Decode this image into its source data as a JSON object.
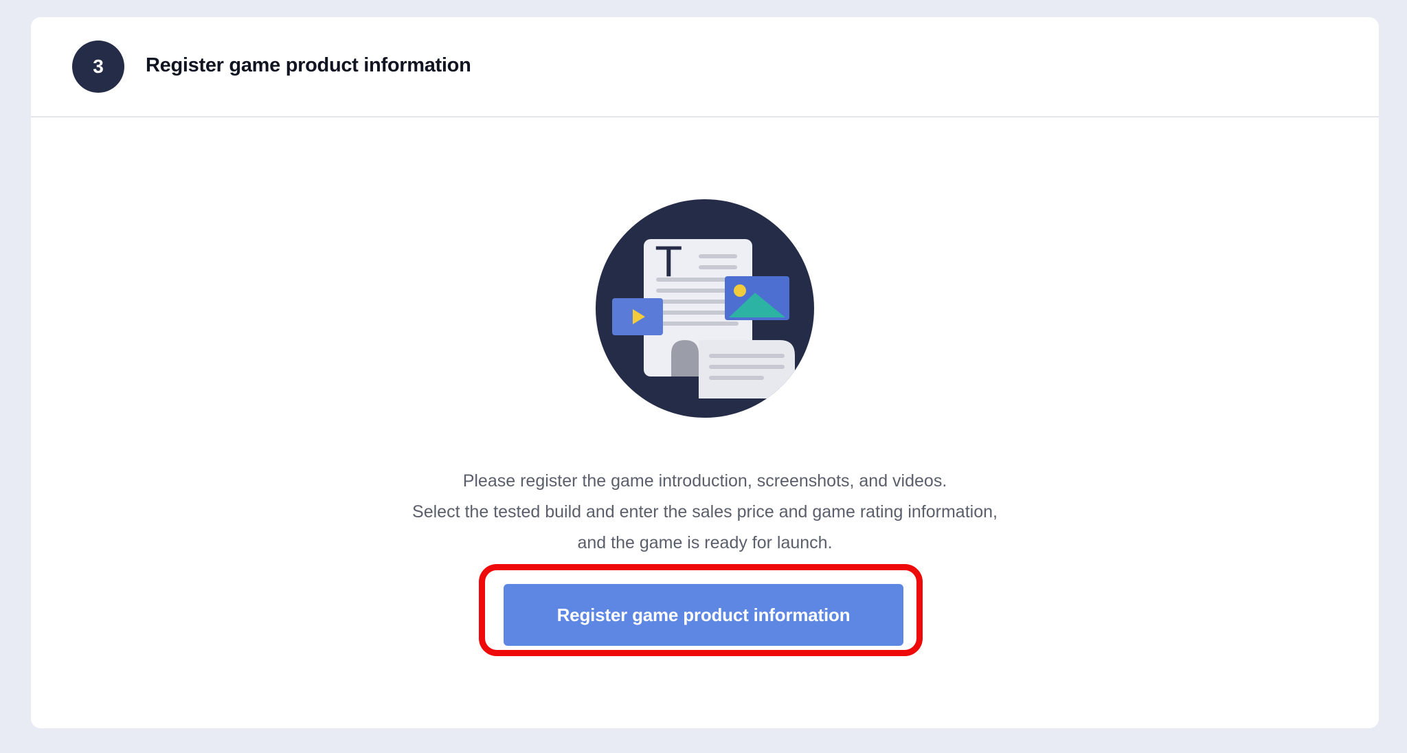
{
  "step": {
    "number": "3",
    "title": "Register game product information"
  },
  "description": {
    "line1": "Please register the game introduction, screenshots, and videos.",
    "line2": "Select the tested build and enter the sales price and game rating information,",
    "line3": "and the game is ready for launch."
  },
  "actions": {
    "register_button_label": "Register game product information"
  },
  "illustration": {
    "icon": "document-media-icon",
    "title_glyph": "T"
  },
  "colors": {
    "background": "#e8ebf3",
    "badge": "#252c47",
    "button": "#5d87e3",
    "highlight": "#ee0a0a"
  }
}
